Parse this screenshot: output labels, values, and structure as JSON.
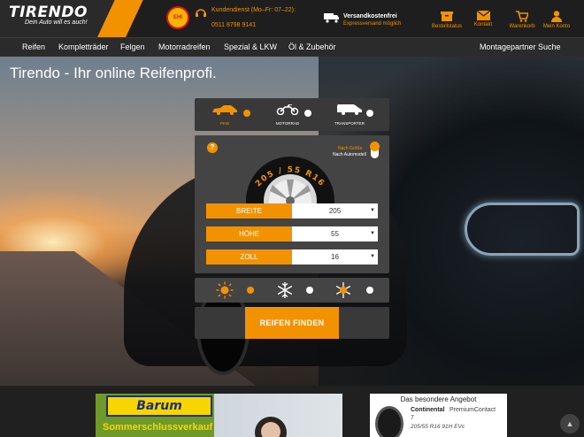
{
  "header": {
    "logo": "TIRENDO",
    "slogan": "Dein Auto will es auch!",
    "badge": "EHI",
    "service_label": "Kundendienst (Mo–Fr: 07–22):",
    "service_phone": "0511 8798 9141",
    "shipping_title": "Versandkostenfrei",
    "shipping_sub": "Expressversand möglich",
    "tools": [
      {
        "label": "Bestellstatus",
        "icon": "package-icon"
      },
      {
        "label": "Kontakt",
        "icon": "mail-icon"
      },
      {
        "label": "Warenkorb",
        "icon": "cart-icon"
      },
      {
        "label": "Mein Konto",
        "icon": "user-icon"
      }
    ],
    "accent": "#f39200"
  },
  "nav": {
    "items": [
      "Reifen",
      "Kompletträder",
      "Felgen",
      "Motorradreifen",
      "Spezial & LKW",
      "Öl & Zubehör"
    ],
    "right": "Montagepartner Suche"
  },
  "hero": {
    "title": "Tirendo - Ihr online Reifenprofi."
  },
  "search": {
    "vehicles": [
      {
        "label": "PKW",
        "icon": "car-icon",
        "selected": true
      },
      {
        "label": "MOTORRAD",
        "icon": "motorcycle-icon",
        "selected": false
      },
      {
        "label": "TRANSPORTER",
        "icon": "van-icon",
        "selected": false
      }
    ],
    "help": "?",
    "mode_size": "Nach Größe",
    "mode_model": "Nach Automodell",
    "tire_text": "205 / 55 R16",
    "fields": [
      {
        "label": "BREITE",
        "value": "205"
      },
      {
        "label": "HÖHE",
        "value": "55"
      },
      {
        "label": "ZOLL",
        "value": "16"
      }
    ],
    "seasons": [
      {
        "name": "summer",
        "icon": "sun-icon",
        "selected": true
      },
      {
        "name": "winter",
        "icon": "snowflake-icon",
        "selected": false
      },
      {
        "name": "allseason",
        "icon": "sun-snow-icon",
        "selected": false
      }
    ],
    "button": "REIFEN FINDEN"
  },
  "promo": {
    "brand": "Barum",
    "text": "Sommerschlussverkauf"
  },
  "offer": {
    "title": "Das besondere Angebot",
    "brand": "Continental",
    "model": "PremiumContact",
    "model_num": "7",
    "size": "205/55 R16 91H EVc"
  }
}
